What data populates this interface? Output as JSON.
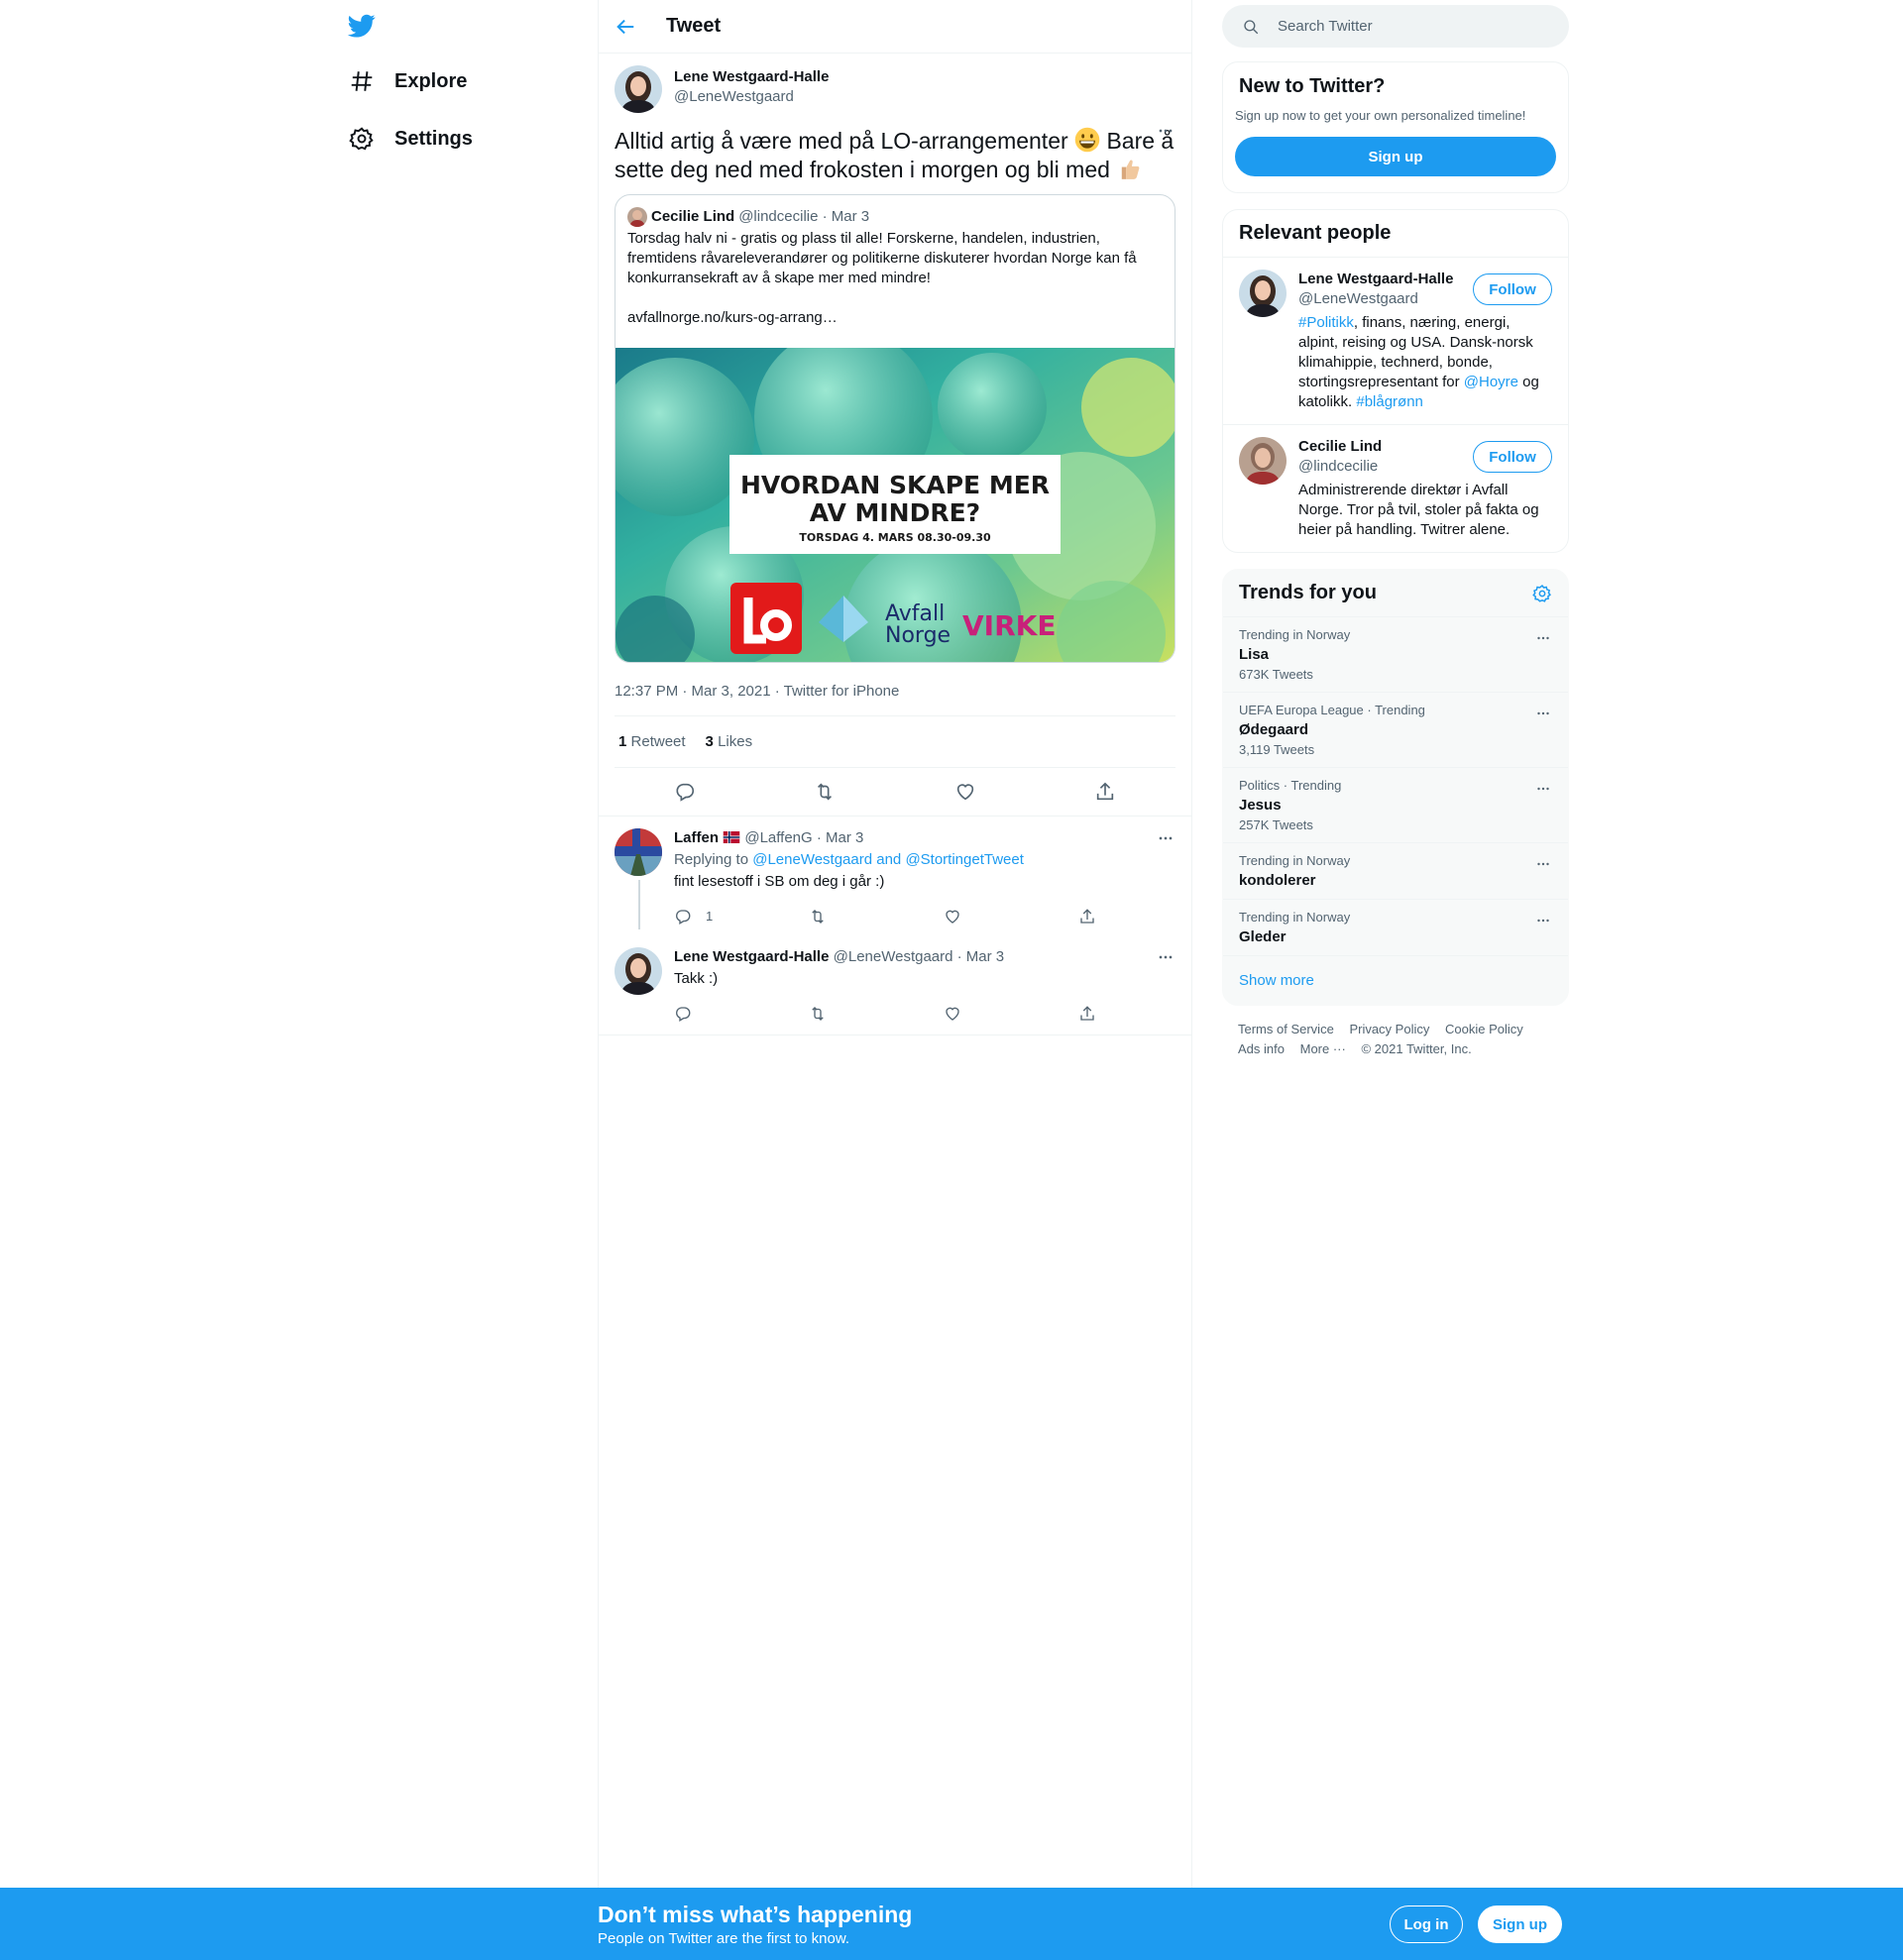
{
  "nav": {
    "explore_label": "Explore",
    "settings_label": "Settings"
  },
  "header": {
    "title": "Tweet"
  },
  "tweet": {
    "author_name": "Lene Westgaard-Halle",
    "author_handle": "@LeneWestgaard",
    "text_part1": "Alltid artig å være med på LO-arrangementer",
    "text_part2": "Bare å sette deg ned med frokosten i morgen og bli med",
    "quote": {
      "name": "Cecilie Lind",
      "handle_date": "@lindcecilie · Mar 3",
      "text": "Torsdag halv ni - gratis og plass til alle! Forskerne, handelen, industrien, fremtidens råvareleverandører og politikerne diskuterer hvordan Norge kan få konkurransekraft av å skape mer med mindre!",
      "link": "avfallnorge.no/kurs-og-arrang…",
      "image": {
        "headline_line1": "HVORDAN SKAPE MER",
        "headline_line2": "AV MINDRE?",
        "subline": "TORSDAG 4. MARS 08.30-09.30",
        "logo_avfall_1": "Avfall",
        "logo_avfall_2": "Norge",
        "logo_virke": "VIRKE"
      }
    },
    "meta": "12:37 PM · Mar 3, 2021 · Twitter for iPhone",
    "retweets_count": "1",
    "retweets_label": "Retweet",
    "likes_count": "3",
    "likes_label": "Likes"
  },
  "replies": [
    {
      "name": "Laffen",
      "handle_date": "@LaffenG · Mar 3",
      "replying_prefix": "Replying to",
      "replying_to": "@LeneWestgaard and @StortingetTweet",
      "text": "fint lesestoff i SB om deg i går :)",
      "reply_count": "1"
    },
    {
      "name": "Lene Westgaard-Halle",
      "handle_date": "@LeneWestgaard · Mar 3",
      "text": "Takk :)"
    }
  ],
  "search": {
    "placeholder": "Search Twitter"
  },
  "new_card": {
    "title": "New to Twitter?",
    "subtitle": "Sign up now to get your own personalized timeline!",
    "signup_label": "Sign up"
  },
  "relevant": {
    "title": "Relevant people",
    "follow_label": "Follow",
    "people": [
      {
        "name": "Lene Westgaard-Halle",
        "handle": "@LeneWestgaard",
        "bio_tag1": "#Politikk",
        "bio_text1": ", finans, næring, energi, alpint, reising og USA. Dansk-norsk klimahippie, technerd, bonde, stortingsrepresentant for ",
        "bio_mention": "@Hoyre",
        "bio_text2": " og katolikk. ",
        "bio_tag2": "#blågrønn"
      },
      {
        "name": "Cecilie Lind",
        "handle": "@lindcecilie",
        "bio": "Administrerende direktør i Avfall Norge. Tror på tvil, stoler på fakta og heier på handling. Twitrer alene."
      }
    ]
  },
  "trends": {
    "title": "Trends for you",
    "items": [
      {
        "context": "Trending in Norway",
        "name": "Lisa",
        "count": "673K Tweets"
      },
      {
        "context": "UEFA Europa League · Trending",
        "name": "Ødegaard",
        "count": "3,119 Tweets"
      },
      {
        "context": "Politics · Trending",
        "name": "Jesus",
        "count": "257K Tweets"
      },
      {
        "context": "Trending in Norway",
        "name": "kondolerer",
        "count": ""
      },
      {
        "context": "Trending in Norway",
        "name": "Gleder",
        "count": ""
      }
    ],
    "show_more": "Show more"
  },
  "footer": {
    "terms": "Terms of Service",
    "privacy": "Privacy Policy",
    "cookie": "Cookie Policy",
    "ads": "Ads info",
    "more": "More ···",
    "copyright": "© 2021 Twitter, Inc."
  },
  "bottom_bar": {
    "title": "Don’t miss what’s happening",
    "subtitle": "People on Twitter are the first to know.",
    "login_label": "Log in",
    "signup_label": "Sign up"
  },
  "colors": {
    "brand": "#1d9bf0",
    "text": "#0f1419",
    "secondary": "#536471"
  }
}
